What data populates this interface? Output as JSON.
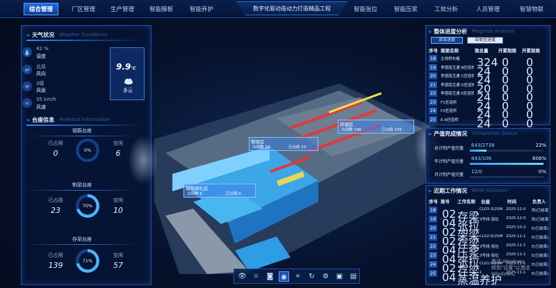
{
  "nav": {
    "items": [
      "综合管理",
      "厂区管理",
      "生产管理",
      "智能模板",
      "智能养护",
      "智能张拉",
      "智能压浆",
      "工效分析",
      "人员管理",
      "智慧物联"
    ],
    "title": "数字化驱动造动力打造精品工程"
  },
  "weather": {
    "title": "天气状况",
    "title_en": "Weather Conditions",
    "items": [
      {
        "icon": "humidity-icon",
        "value": "42 %",
        "label": "湿度"
      },
      {
        "icon": "wind-direction-icon",
        "value": "北风",
        "label": "风向"
      },
      {
        "icon": "wind-level-icon",
        "value": "3级",
        "label": "风级"
      },
      {
        "icon": "wind-speed-icon",
        "value": "35 km/h",
        "label": "风速"
      }
    ],
    "temperature": "9.9",
    "temp_unit": "℃",
    "condition": "多云"
  },
  "stations": {
    "title": "台座信息",
    "title_en": "Pedestal information",
    "groups": [
      {
        "name": "钢筋台座",
        "used_label": "已占用",
        "free_label": "空闲",
        "used": "0",
        "percent": "0%",
        "free": "6",
        "fraction": 0.0
      },
      {
        "name": "制梁台座",
        "used_label": "已占用",
        "free_label": "空闲",
        "used": "23",
        "percent": "70%",
        "free": "10",
        "fraction": 0.7
      },
      {
        "name": "存梁台座",
        "used_label": "已占用",
        "free_label": "空闲",
        "used": "139",
        "percent": "71%",
        "free": "57",
        "fraction": 0.71
      }
    ]
  },
  "scene": {
    "tips": [
      {
        "title": "存梁区",
        "used_label": "占用数",
        "used": "196",
        "occupied_label": "已占用",
        "occupied": "139"
      },
      {
        "title": "制梁区",
        "used_label": "占用数",
        "used": "33",
        "occupied_label": "已占用",
        "occupied": "23"
      },
      {
        "title": "钢筋绑扎区",
        "used_label": "占用数",
        "used": "6",
        "occupied_label": "已占用",
        "occupied": "0"
      }
    ]
  },
  "progress": {
    "title": "整体进度分析",
    "title_en": "Progress Analysis",
    "tabs": [
      "梁梁进度",
      "梁类型进度"
    ],
    "headers": [
      "序号",
      "梁梁名称",
      "梁总量",
      "开累制梁",
      "开累架梁"
    ],
    "rows": [
      [
        "18",
        "主线桥右幅",
        "324",
        "0",
        "0"
      ],
      [
        "19",
        "孝感南互通 B匝道桥",
        "24",
        "0",
        "0"
      ],
      [
        "20",
        "孝感南互通 C匝道桥",
        "24",
        "0",
        "0"
      ],
      [
        "21",
        "孝感南互通 D匝道桥",
        "20",
        "0",
        "0"
      ],
      [
        "22",
        "孝感南互通 E匝道桥",
        "24",
        "0",
        "0"
      ],
      [
        "23",
        "F1匝道桥",
        "24",
        "0",
        "0"
      ],
      [
        "24",
        "F2匝道桥",
        "24",
        "0",
        "0"
      ],
      [
        "25",
        "K A匝道桥",
        "24",
        "0",
        "0"
      ]
    ]
  },
  "completion": {
    "title": "产值完成情况",
    "title_en": "Completion Status",
    "rows": [
      {
        "label": "总计制产值完量",
        "value": "643/2738",
        "pct": "23%",
        "fraction": 0.23
      },
      {
        "label": "年计制产值完量",
        "value": "643/106",
        "pct": "606%",
        "fraction": 1.0
      },
      {
        "label": "月计制产值完量",
        "value": "12/0",
        "pct": "0%",
        "fraction": 0.0
      }
    ]
  },
  "work": {
    "title": "近期工作情况",
    "title_en": "Work Situation",
    "headers": [
      "序号",
      "梁号",
      "工作名称",
      "台座",
      "时间",
      "负责人"
    ],
    "rows": [
      [
        "18",
        "02",
        "存梁",
        "CL03-3(2SM",
        "2025-12-0",
        "凯(已结束)"
      ],
      [
        "19",
        "04",
        "张拉",
        "3号线-张拉",
        "2025-12-0",
        "凯(已结束)"
      ],
      [
        "20",
        "02",
        "架梁",
        "",
        "2025-10-2",
        "E(已结束)"
      ],
      [
        "21",
        "02",
        "存梁",
        "CL02-6(2SM",
        "2025-11-1",
        "E(已结束)"
      ],
      [
        "22",
        "04",
        "压浆",
        "3号线-张拉",
        "2025-11-1",
        "E(已结束)"
      ],
      [
        "23",
        "04",
        "张拉",
        "3号线-张拉",
        "2025-11-1",
        "E(已结束)"
      ],
      [
        "24",
        "02",
        "存梁",
        "CL01-5(2SM",
        "2025-11-1",
        "E(已结束)"
      ],
      [
        "25",
        "04",
        "蒸温养护",
        "1",
        "2025-11-1",
        "E(已结束)"
      ]
    ]
  },
  "toolbar": [
    "eye-icon",
    "scan-icon",
    "camera-icon",
    "view-icon",
    "crop-icon",
    "rotate-icon",
    "settings-icon",
    "cube-icon",
    "layers-icon"
  ],
  "watermark": [
    "激活 Windows",
    "转到\"设置\"以激活 Windows。"
  ]
}
